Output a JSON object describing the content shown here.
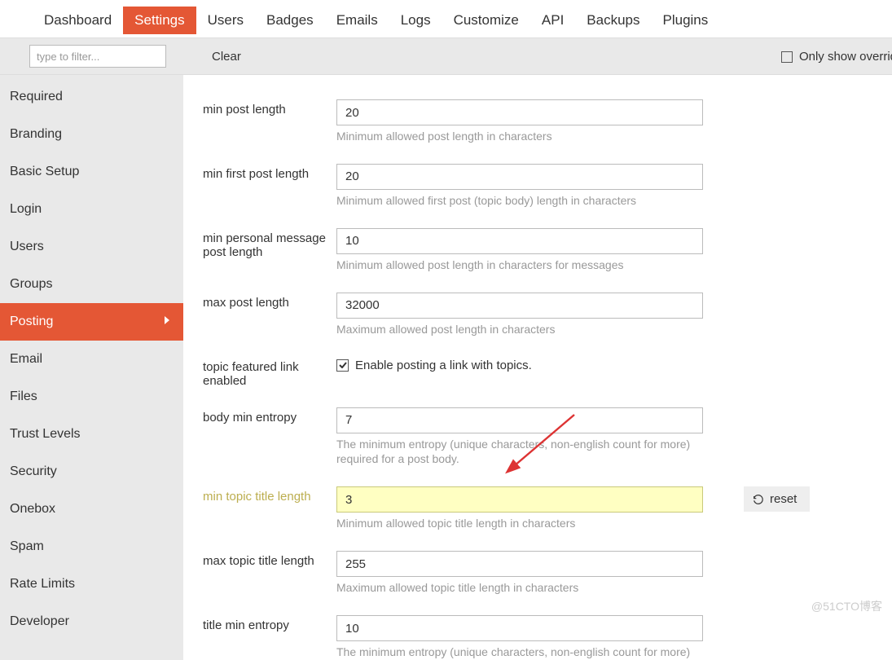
{
  "top_tabs": {
    "dashboard": "Dashboard",
    "settings": "Settings",
    "users": "Users",
    "badges": "Badges",
    "emails": "Emails",
    "logs": "Logs",
    "customize": "Customize",
    "api": "API",
    "backups": "Backups",
    "plugins": "Plugins"
  },
  "filter": {
    "placeholder": "type to filter...",
    "clear": "Clear",
    "only_override": "Only show overrid"
  },
  "sidebar": {
    "required": "Required",
    "branding": "Branding",
    "basic_setup": "Basic Setup",
    "login": "Login",
    "users": "Users",
    "groups": "Groups",
    "posting": "Posting",
    "email": "Email",
    "files": "Files",
    "trust_levels": "Trust Levels",
    "security": "Security",
    "onebox": "Onebox",
    "spam": "Spam",
    "rate_limits": "Rate Limits",
    "developer": "Developer"
  },
  "settings": {
    "min_post_length": {
      "label": "min post length",
      "value": "20",
      "help": "Minimum allowed post length in characters"
    },
    "min_first_post_length": {
      "label": "min first post length",
      "value": "20",
      "help": "Minimum allowed first post (topic body) length in characters"
    },
    "min_personal_message_post_length": {
      "label": "min personal message post length",
      "value": "10",
      "help": "Minimum allowed post length in characters for messages"
    },
    "max_post_length": {
      "label": "max post length",
      "value": "32000",
      "help": "Maximum allowed post length in characters"
    },
    "topic_featured_link_enabled": {
      "label": "topic featured link enabled",
      "cb_label": "Enable posting a link with topics."
    },
    "body_min_entropy": {
      "label": "body min entropy",
      "value": "7",
      "help": "The minimum entropy (unique characters, non-english count for more) required for a post body."
    },
    "min_topic_title_length": {
      "label": "min topic title length",
      "value": "3",
      "help": "Minimum allowed topic title length in characters"
    },
    "max_topic_title_length": {
      "label": "max topic title length",
      "value": "255",
      "help": "Maximum allowed topic title length in characters"
    },
    "title_min_entropy": {
      "label": "title min entropy",
      "value": "10",
      "help": "The minimum entropy (unique characters, non-english count for more)"
    }
  },
  "reset": "reset",
  "watermark": "@51CTO博客"
}
